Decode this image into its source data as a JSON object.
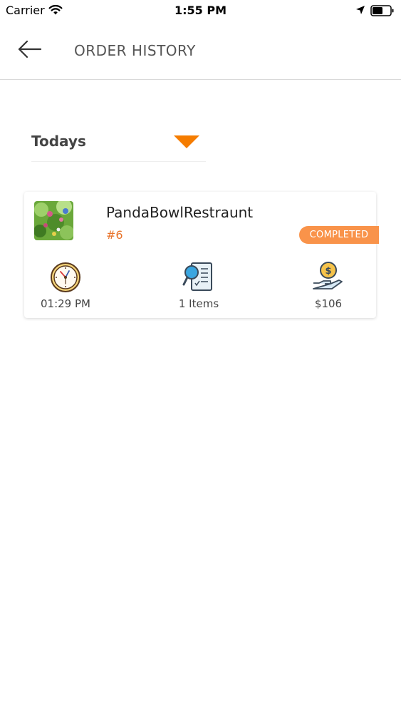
{
  "status_bar": {
    "carrier": "Carrier",
    "time": "1:55 PM"
  },
  "header": {
    "title": "ORDER HISTORY",
    "back_icon": "arrow-left-icon"
  },
  "filter": {
    "label": "Todays",
    "icon": "caret-down-icon"
  },
  "orders": [
    {
      "restaurant": "PandaBowlRestraunt",
      "order_number": "#6",
      "status": "COMPLETED",
      "time": "01:29 PM",
      "items": "1 Items",
      "price": "$106"
    }
  ],
  "colors": {
    "accent": "#f57c00",
    "badge": "#f9934a",
    "order_number": "#e8732a"
  }
}
